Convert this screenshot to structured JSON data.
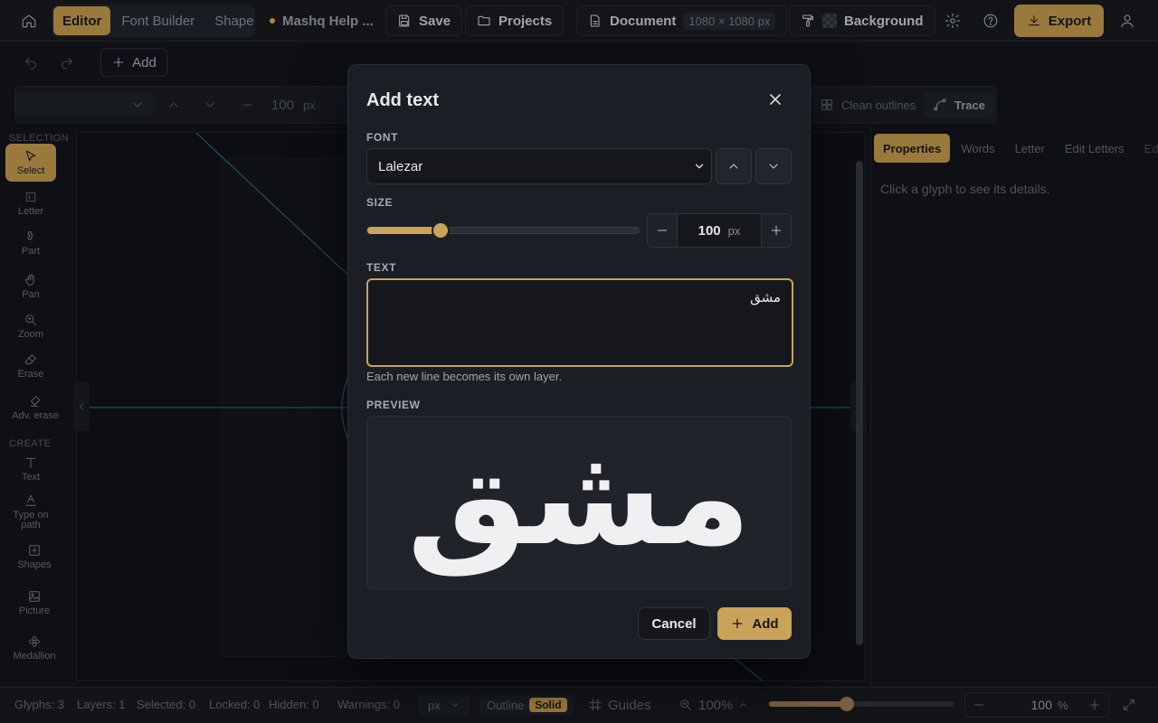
{
  "topbar": {
    "tabs": [
      {
        "label": "Editor",
        "active": true
      },
      {
        "label": "Font Builder",
        "active": false
      },
      {
        "label": "Shape Builder",
        "active": false
      }
    ],
    "project_name": "Mashq Help ...",
    "save_label": "Save",
    "projects_label": "Projects",
    "document_label": "Document",
    "document_size": "1080 × 1080 px",
    "background_label": "Background",
    "export_label": "Export"
  },
  "toolbar2": {
    "add_label": "Add"
  },
  "toolbar3": {
    "size_value": "100",
    "size_unit": "px",
    "clean_outlines_label": "Clean outlines",
    "trace_label": "Trace"
  },
  "tools": {
    "selection_header": "SELECTION",
    "create_header": "CREATE",
    "items": [
      {
        "label": "Select",
        "icon": "cursor-icon",
        "active": true
      },
      {
        "label": "Letter",
        "icon": "letter-icon"
      },
      {
        "label": "Part",
        "icon": "part-icon"
      },
      {
        "label": "Pan",
        "icon": "hand-icon"
      },
      {
        "label": "Zoom",
        "icon": "zoom-icon"
      },
      {
        "label": "Erase",
        "icon": "eraser-icon"
      },
      {
        "label": "Adv. erase",
        "icon": "adv-eraser-icon"
      },
      {
        "label": "Text",
        "icon": "text-icon"
      },
      {
        "label": "Type on path",
        "icon": "type-on-path-icon"
      },
      {
        "label": "Shapes",
        "icon": "shapes-icon"
      },
      {
        "label": "Picture",
        "icon": "picture-icon"
      },
      {
        "label": "Medallion",
        "icon": "medallion-icon"
      }
    ]
  },
  "right_panel": {
    "tabs": [
      {
        "label": "Properties",
        "active": true
      },
      {
        "label": "Words"
      },
      {
        "label": "Letter"
      },
      {
        "label": "Edit Letters"
      },
      {
        "label": "Edit"
      }
    ],
    "hint": "Click a glyph to see its details."
  },
  "status": {
    "glyphs": "Glyphs: 3",
    "layers": "Layers: 1",
    "selected": "Selected: 0",
    "locked": "Locked: 0",
    "hidden": "Hidden: 0",
    "warnings": "Warnings: 0",
    "unit": "px",
    "outline_label": "Outline",
    "solid_label": "Solid",
    "guides_label": "Guides",
    "zoom_value": "100%",
    "zoom_level": 0.42,
    "zoom_input": "100",
    "zoom_unit": "%"
  },
  "dialog": {
    "title": "Add text",
    "font_label": "FONT",
    "font_value": "Lalezar",
    "size_label": "SIZE",
    "size_slider_level": 0.27,
    "size_value": "100",
    "size_unit": "px",
    "text_label": "TEXT",
    "text_value": "مشق",
    "text_help": "Each new line becomes its own layer.",
    "preview_label": "PREVIEW",
    "preview_text": "مشق",
    "cancel_label": "Cancel",
    "add_label": "Add"
  },
  "colors": {
    "accent": "#b08a45",
    "accent_bright": "#c9a35a",
    "background": "#111318",
    "guide_line": "#1f5f73"
  }
}
